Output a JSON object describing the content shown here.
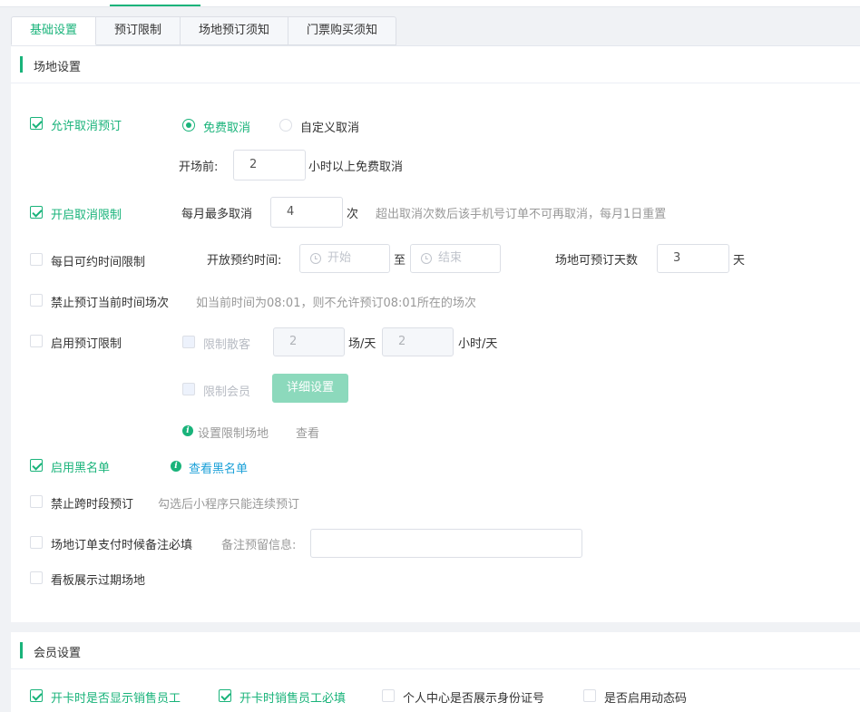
{
  "tabs": [
    {
      "label": "基础设置",
      "active": true
    },
    {
      "label": "预订限制",
      "active": false
    },
    {
      "label": "场地预订须知",
      "active": false
    },
    {
      "label": "门票购买须知",
      "active": false
    }
  ],
  "venue_section": {
    "title": "场地设置",
    "allow_cancel": {
      "label": "允许取消预订",
      "checked": true,
      "radio_free": "免费取消",
      "radio_custom": "自定义取消",
      "before_label": "开场前:",
      "hours_value": "2",
      "hours_suffix": "小时以上免费取消"
    },
    "cancel_limit": {
      "label": "开启取消限制",
      "checked": true,
      "monthly_label": "每月最多取消",
      "monthly_value": "4",
      "unit": "次",
      "hint": "超出取消次数后该手机号订单不可再取消，每月1日重置"
    },
    "daily_time_limit": {
      "label": "每日可约时间限制",
      "checked": false,
      "open_label": "开放预约时间:",
      "start_placeholder": "开始",
      "to": "至",
      "end_placeholder": "结束",
      "days_label": "场地可预订天数",
      "days_value": "3",
      "days_unit": "天"
    },
    "forbid_current": {
      "label": "禁止预订当前时间场次",
      "checked": false,
      "hint": "如当前时间为08:01，则不允许预订08:01所在的场次"
    },
    "booking_limit": {
      "label": "启用预订限制",
      "checked": false,
      "guest_label": "限制散客",
      "guest_sessions_value": "2",
      "sessions_unit": "场/天",
      "guest_hours_value": "2",
      "hours_unit": "小时/天",
      "member_label": "限制会员",
      "detail_button": "详细设置",
      "set_venue_label": "设置限制场地",
      "view_link": "查看"
    },
    "blacklist": {
      "label": "启用黑名单",
      "checked": true,
      "view_link": "查看黑名单"
    },
    "forbid_cross": {
      "label": "禁止跨时段预订",
      "checked": false,
      "hint": "勾选后小程序只能连续预订"
    },
    "remark_required": {
      "label": "场地订单支付时候备注必填",
      "checked": false,
      "remark_label": "备注预留信息:",
      "remark_value": ""
    },
    "board_expired": {
      "label": "看板展示过期场地",
      "checked": false
    }
  },
  "member_section": {
    "title": "会员设置",
    "items": [
      {
        "label": "开卡时是否显示销售员工",
        "checked": true
      },
      {
        "label": "开卡时销售员工必填",
        "checked": true
      },
      {
        "label": "个人中心是否展示身份证号",
        "checked": false
      },
      {
        "label": "是否启用动态码",
        "checked": false
      }
    ]
  },
  "colors": {
    "accent": "#19b37a",
    "link": "#1aa0d8",
    "disabled_button": "#8cd9bc"
  }
}
